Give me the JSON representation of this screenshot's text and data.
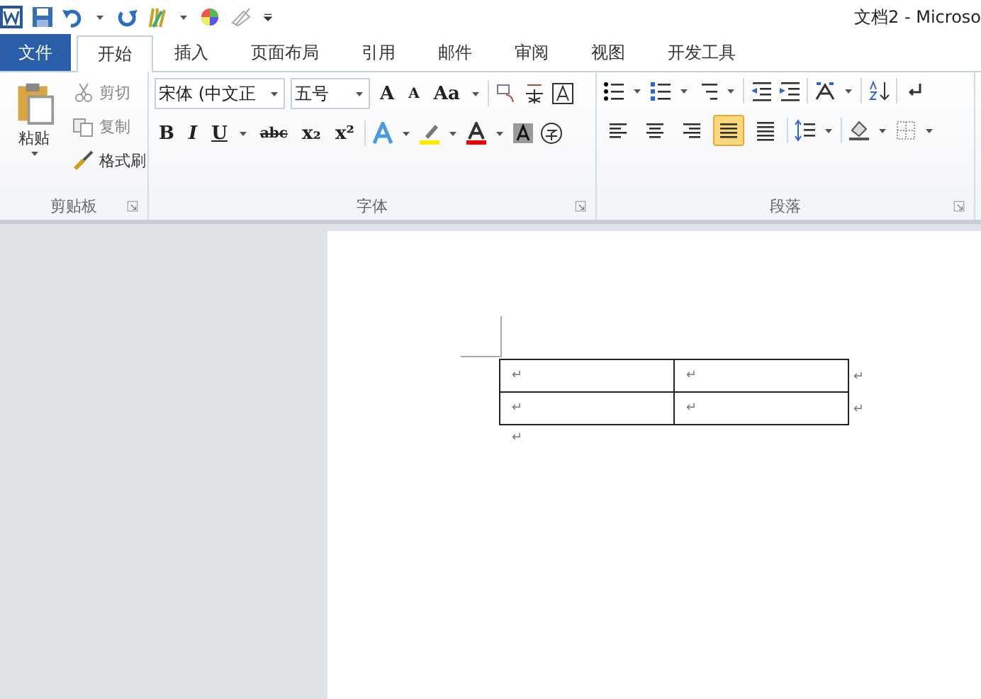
{
  "window": {
    "title": "文档2 - Microso"
  },
  "tabs": [
    {
      "label": "文件",
      "kind": "file",
      "selected": false
    },
    {
      "label": "开始",
      "kind": "tab",
      "selected": true
    },
    {
      "label": "插入",
      "kind": "tab",
      "selected": false
    },
    {
      "label": "页面布局",
      "kind": "tab",
      "selected": false
    },
    {
      "label": "引用",
      "kind": "tab",
      "selected": false
    },
    {
      "label": "邮件",
      "kind": "tab",
      "selected": false
    },
    {
      "label": "审阅",
      "kind": "tab",
      "selected": false
    },
    {
      "label": "视图",
      "kind": "tab",
      "selected": false
    },
    {
      "label": "开发工具",
      "kind": "tab",
      "selected": false
    }
  ],
  "clipboard": {
    "paste": "粘贴",
    "cut": "剪切",
    "copy": "复制",
    "format_painter": "格式刷",
    "label": "剪贴板"
  },
  "font": {
    "name": "宋体 (中文正",
    "size": "五号",
    "row1": [
      "A",
      "A",
      "Aa"
    ],
    "row2": [
      "B",
      "I",
      "U",
      "abc",
      "x₂",
      "x²"
    ],
    "label": "字体"
  },
  "paragraph": {
    "alignment": [
      {
        "selected": false
      },
      {
        "selected": false
      },
      {
        "selected": false
      },
      {
        "selected": true
      },
      {
        "selected": false
      }
    ],
    "label": "段落"
  },
  "document": {
    "table": [
      [
        "↵",
        "↵"
      ],
      [
        "↵",
        "↵"
      ]
    ],
    "row_marks": [
      "↵",
      "↵"
    ],
    "after_table": "↵"
  }
}
